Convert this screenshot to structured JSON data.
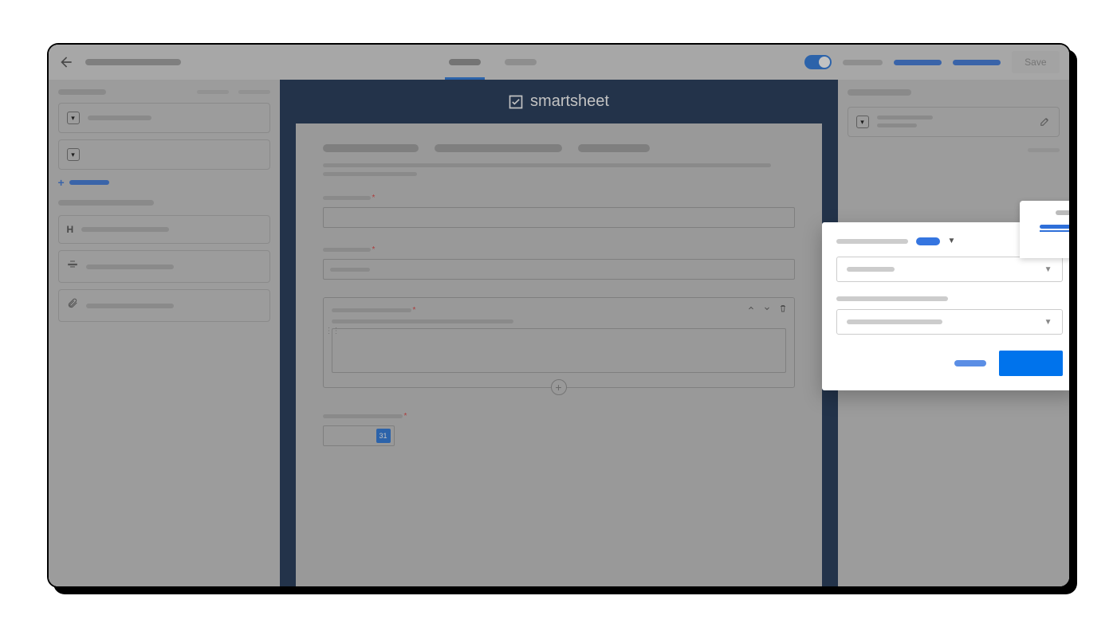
{
  "header": {
    "save_label": "Save",
    "toggle_on": true
  },
  "brand": {
    "name": "smartsheet"
  },
  "left_panel": {
    "add_icon": "+",
    "heading_icon": "H",
    "attachment_icon": "clip"
  },
  "form": {
    "calendar_day": "31",
    "add_option": "+"
  },
  "popup": {
    "dropdown_arrow": "▼"
  }
}
